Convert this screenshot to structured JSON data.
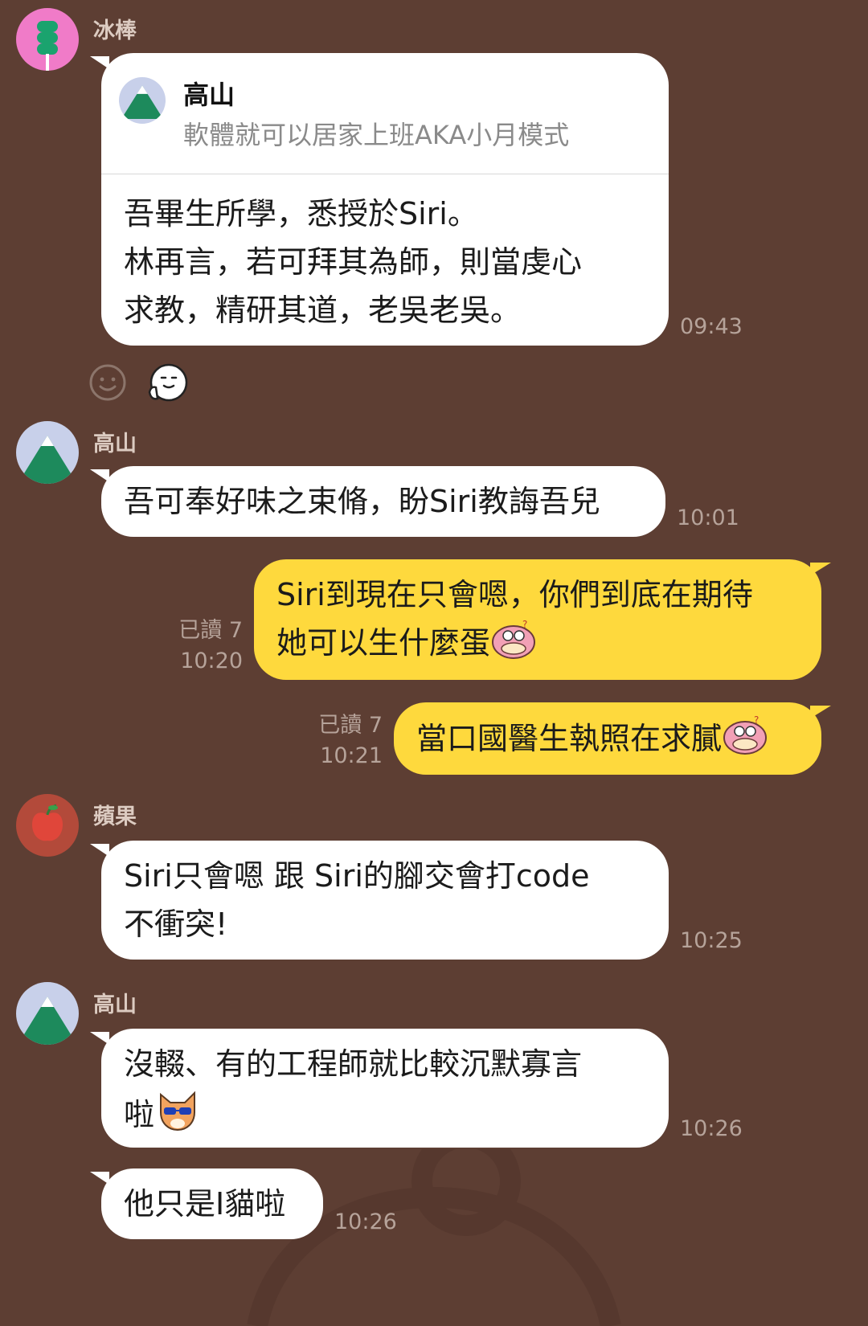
{
  "colors": {
    "background": "#5d3e33",
    "incoming_bubble": "#ffffff",
    "outgoing_bubble": "#fed93d",
    "meta_text": "#b6a39a",
    "sender_text": "#dccbc1"
  },
  "messages": [
    {
      "sender": "冰棒",
      "avatar": "popsicle-avatar",
      "reply": {
        "name": "高山",
        "snippet": "軟體就可以居家上班AKA小月模式",
        "avatar": "mountain-avatar"
      },
      "lines": [
        "吾畢生所學，悉授於Siri。",
        "林再言，若可拜其為師，則當虔心",
        "求教，精研其道，老吳老吳。"
      ],
      "time": "09:43",
      "reactions": [
        "smiley-reaction-icon",
        "thumbs-up-reaction-sticker"
      ]
    },
    {
      "sender": "高山",
      "avatar": "mountain-avatar",
      "lines": [
        "吾可奉好味之束脩，盼Siri教誨吾兒"
      ],
      "time": "10:01"
    },
    {
      "outgoing": true,
      "read": "已讀 7",
      "time": "10:20",
      "lines": [
        "Siri到現在只會嗯，你們到底在期待",
        "她可以生什麼蛋"
      ],
      "sticker": "slowpoke-emoji"
    },
    {
      "outgoing": true,
      "read": "已讀 7",
      "time": "10:21",
      "lines": [
        "當口國醫生執照在求膩"
      ],
      "sticker": "slowpoke-emoji"
    },
    {
      "sender": "蘋果",
      "avatar": "apple-avatar",
      "lines": [
        "Siri只會嗯 跟 Siri的腳交會打code",
        "不衝突!"
      ],
      "time": "10:25"
    },
    {
      "sender": "高山",
      "avatar": "mountain-avatar",
      "lines": [
        "沒輟、有的工程師就比較沉默寡言",
        "啦"
      ],
      "sticker": "cool-fox-emoji",
      "time": "10:26"
    },
    {
      "continued": true,
      "lines": [
        "他只是I貓啦"
      ],
      "time": "10:26"
    }
  ]
}
